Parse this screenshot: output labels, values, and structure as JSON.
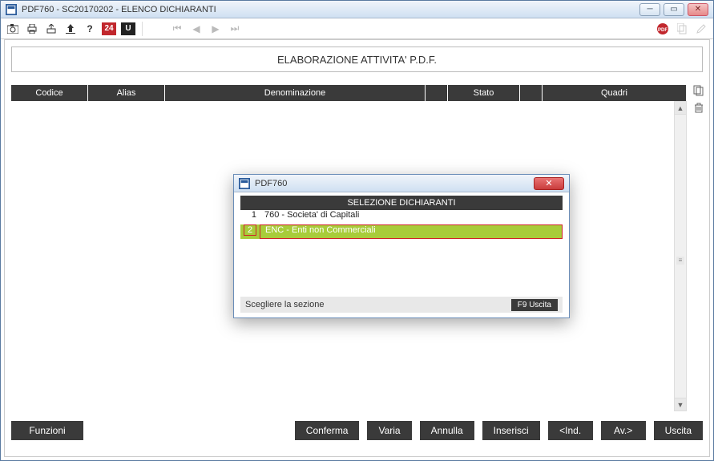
{
  "window_title": "PDF760  - SC20170202 -  ELENCO DICHIARANTI",
  "toolbar": {
    "badge24": "24",
    "badgeU": "U",
    "pdf_icon": "PDF"
  },
  "banner_title": "ELABORAZIONE ATTIVITA' P.D.F.",
  "grid_headers": {
    "codice": "Codice",
    "alias": "Alias",
    "denominazione": "Denominazione",
    "stato": "Stato",
    "quadri": "Quadri"
  },
  "buttons": {
    "funzioni": "Funzioni",
    "conferma": "Conferma",
    "varia": "Varia",
    "annulla": "Annulla",
    "inserisci": "Inserisci",
    "ind": "<Ind.",
    "av": "Av.>",
    "uscita": "Uscita"
  },
  "dialog": {
    "title": "PDF760",
    "header": "SELEZIONE DICHIARANTI",
    "rows": [
      {
        "num": "1",
        "text": "760 - Societa' di Capitali"
      },
      {
        "num": "2",
        "text": "ENC - Enti non Commerciali"
      }
    ],
    "footer_text": "Scegliere la sezione",
    "f9_label": "F9 Uscita"
  }
}
